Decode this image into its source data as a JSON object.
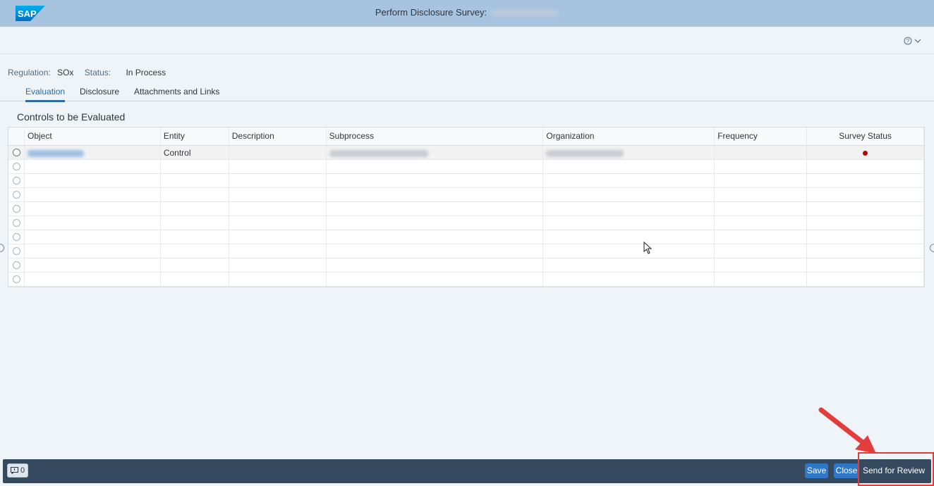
{
  "shell": {
    "logo_text": "SAP",
    "title": "Perform Disclosure Survey:"
  },
  "help": {
    "label": "?"
  },
  "info": {
    "regulation_label": "Regulation:",
    "regulation_value": "SOx",
    "status_label": "Status:",
    "status_value": "In Process"
  },
  "tabs": [
    {
      "label": "Evaluation",
      "active": true
    },
    {
      "label": "Disclosure",
      "active": false
    },
    {
      "label": "Attachments and Links",
      "active": false
    }
  ],
  "section_title": "Controls to be Evaluated",
  "table": {
    "columns": [
      "Object",
      "Entity",
      "Description",
      "Subprocess",
      "Organization",
      "Frequency",
      "Survey Status"
    ],
    "rows": [
      {
        "entity": "Control",
        "survey_status_color": "#bb0000"
      }
    ],
    "empty_rows": 9
  },
  "footer": {
    "messages_count": "0",
    "save_label": "Save",
    "close_label": "Close",
    "send_for_review_label": "Send for Review"
  },
  "colors": {
    "shell": "#a7c3de",
    "accent": "#2f78c8",
    "footer": "#354a5f",
    "annotation": "#e33c3c",
    "status_red": "#bb0000"
  }
}
